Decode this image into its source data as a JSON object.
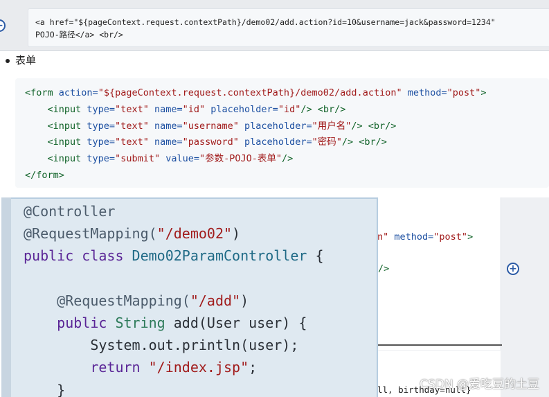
{
  "top_code": {
    "line1": "<a href=\"${pageContext.request.contextPath}/demo02/add.action?id=10&username=jack&password=1234\"",
    "line2": "POJO-路径</a> <br/>"
  },
  "section_bullet": "表单",
  "form_code": {
    "l1": {
      "open": "<form ",
      "a1": "action=",
      "v1": "\"${pageContext.request.contextPath}/demo02/add.action\"",
      "sp": " ",
      "a2": "method=",
      "v2": "\"post\"",
      "close": ">"
    },
    "inputs": [
      {
        "open": "<input ",
        "a1": "type=",
        "v1": "\"text\"",
        "a2": "name=",
        "v2": "\"id\"",
        "a3": "placeholder=",
        "v3": "\"id\"",
        "close": "/>",
        "br": "<br/>"
      },
      {
        "open": "<input ",
        "a1": "type=",
        "v1": "\"text\"",
        "a2": "name=",
        "v2": "\"username\"",
        "a3": "placeholder=",
        "v3": "\"用户名\"",
        "close": "/>",
        "br": "<br/>"
      },
      {
        "open": "<input ",
        "a1": "type=",
        "v1": "\"text\"",
        "a2": "name=",
        "v2": "\"password\"",
        "a3": "placeholder=",
        "v3": "\"密码\"",
        "close": "/>",
        "br": "<br/>"
      },
      {
        "open": "<input ",
        "a1": "type=",
        "v1": "\"submit\"",
        "a2": "value=",
        "v2": "\"参数-POJO-表单\"",
        "close": "/>"
      }
    ],
    "end": "</form>"
  },
  "background": {
    "text1_a": "n\" ",
    "text1_attr": "method=",
    "text1_val": "\"post\"",
    "text1_close": ">",
    "text2": "/>",
    "text3": "ll, birthday=null}"
  },
  "popup_code": {
    "l1": "@Controller",
    "l2_ann": "@RequestMapping(",
    "l2_str": "\"/demo02\"",
    "l2_end": ")",
    "l3_kw": "public class ",
    "l3_cls": "Demo02ParamController",
    "l3_end": " {",
    "l5_ann": "@RequestMapping(",
    "l5_str": "\"/add\"",
    "l5_end": ")",
    "l6_kw": "public ",
    "l6_ty": "String",
    "l6_rest": " add(User user) {",
    "l7": "System.out.println(user);",
    "l8_kw": "return ",
    "l8_str": "\"/index.jsp\"",
    "l8_end": ";",
    "l9": "}"
  },
  "watermark": "CSDN @爱吃豆的土豆",
  "icons": {
    "expand": "plus-circle-icon"
  },
  "colors": {
    "tag": "#116329",
    "attr": "#1c4fa1",
    "value": "#a11b1b",
    "popup_bg": "#dfe9f1"
  }
}
